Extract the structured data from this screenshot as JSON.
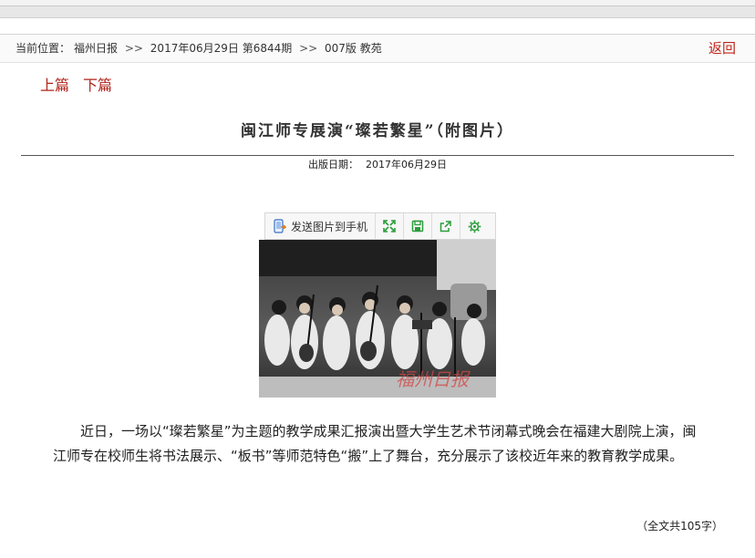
{
  "nav": {
    "location_label": "当前位置：",
    "path": [
      "福州日报",
      "2017年06月29日 第6844期",
      "007版 教苑"
    ],
    "separator": ">>",
    "back_label": "返回"
  },
  "pager": {
    "prev_label": "上篇",
    "next_label": "下篇"
  },
  "article": {
    "title": "闽江师专展演“璨若繁星”（附图片）",
    "date_label": "出版日期：",
    "date_value": "2017年06月29日",
    "body": "近日，一场以“璨若繁星”为主题的教学成果汇报演出暨大学生艺术节闭幕式晚会在福建大剧院上演，闽江师专在校师生将书法展示、“板书”等师范特色“搬”上了舞台，充分展示了该校近年来的教育教学成果。",
    "word_count": "（全文共105字）"
  },
  "image_toolbar": {
    "send_label": "发送图片到手机",
    "buttons": [
      "fullscreen-icon",
      "save-icon",
      "share-icon",
      "settings-icon"
    ]
  },
  "photo": {
    "watermark": "福州日报"
  },
  "colors": {
    "accent": "#c0261c",
    "toolbar_icon": "#2a9d3a"
  }
}
